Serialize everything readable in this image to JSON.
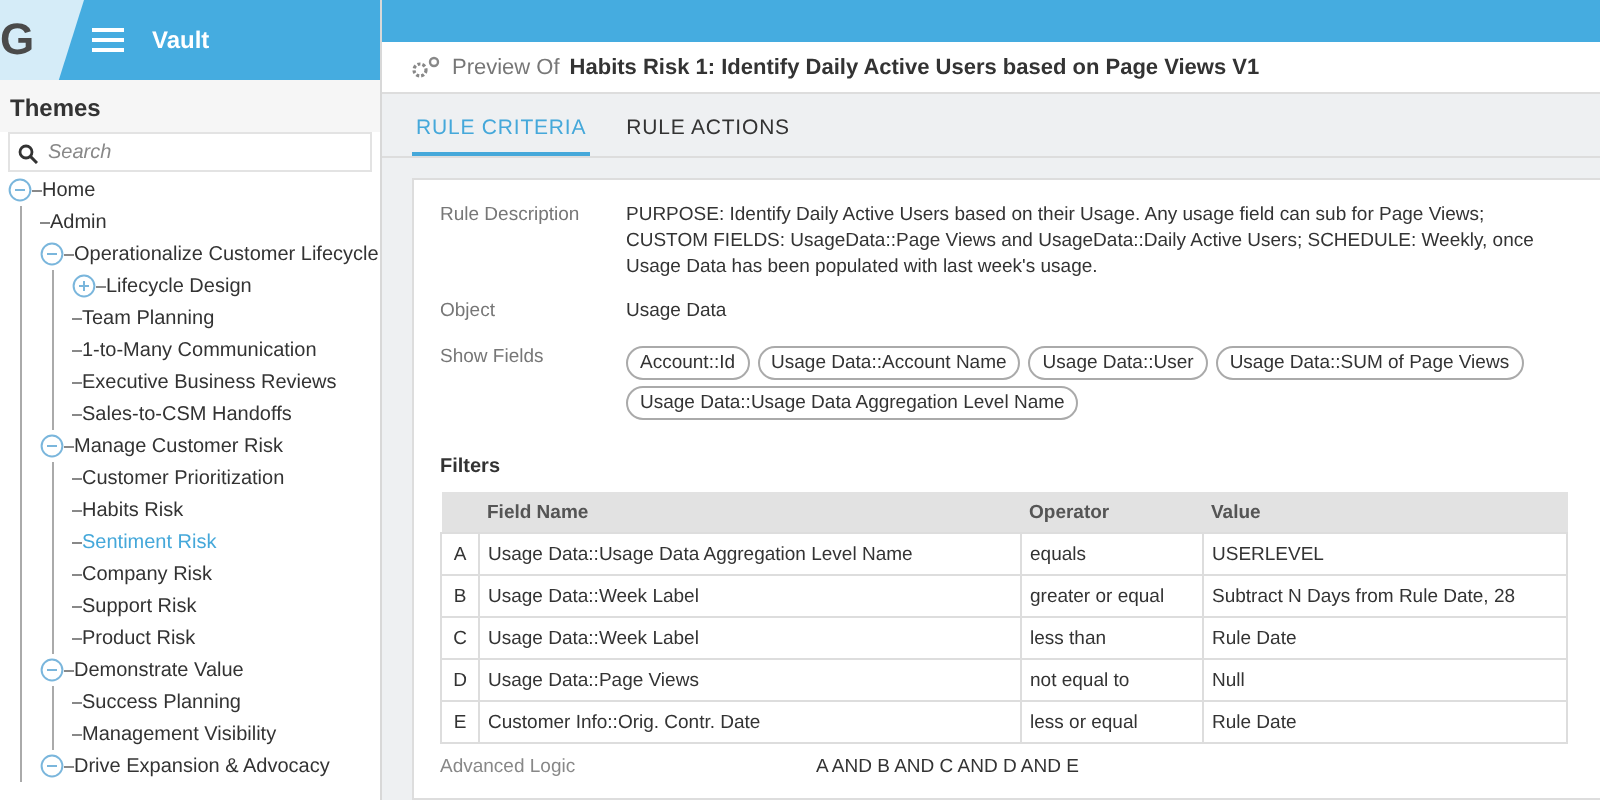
{
  "app": {
    "logo": "G",
    "title": "Vault"
  },
  "sidebar": {
    "heading": "Themes",
    "search": {
      "placeholder": "Search"
    },
    "tree": [
      {
        "label": "Home",
        "expanded": true,
        "selected": false,
        "children": [
          {
            "label": "Admin",
            "selected": false
          },
          {
            "label": "Operationalize Customer Lifecycle",
            "expanded": true,
            "selected": false,
            "children": [
              {
                "label": "Lifecycle Design",
                "expanded": false,
                "selected": false
              },
              {
                "label": "Team Planning",
                "selected": false
              },
              {
                "label": "1-to-Many Communication",
                "selected": false
              },
              {
                "label": "Executive Business Reviews",
                "selected": false
              },
              {
                "label": "Sales-to-CSM Handoffs",
                "selected": false
              }
            ]
          },
          {
            "label": "Manage Customer Risk",
            "expanded": true,
            "selected": false,
            "children": [
              {
                "label": "Customer Prioritization",
                "selected": false
              },
              {
                "label": "Habits Risk",
                "selected": false
              },
              {
                "label": "Sentiment Risk",
                "selected": true
              },
              {
                "label": "Company Risk",
                "selected": false
              },
              {
                "label": "Support Risk",
                "selected": false
              },
              {
                "label": "Product Risk",
                "selected": false
              }
            ]
          },
          {
            "label": "Demonstrate Value",
            "expanded": true,
            "selected": false,
            "children": [
              {
                "label": "Success Planning",
                "selected": false
              },
              {
                "label": "Management Visibility",
                "selected": false
              }
            ]
          },
          {
            "label": "Drive Expansion & Advocacy",
            "expanded": true,
            "selected": false
          }
        ]
      }
    ]
  },
  "preview": {
    "prefix": "Preview Of",
    "title": "Habits Risk 1: Identify Daily Active Users based on Page Views V1",
    "tabs": [
      {
        "label": "RULE CRITERIA",
        "selected": true
      },
      {
        "label": "RULE ACTIONS",
        "selected": false
      }
    ],
    "rule_description_label": "Rule Description",
    "rule_description": "PURPOSE: Identify Daily Active Users based on their Usage. Any usage field can sub for Page Views; CUSTOM FIELDS: UsageData::Page Views and UsageData::Daily Active Users; SCHEDULE: Weekly, once Usage Data has been populated with last week's usage.",
    "object_label": "Object",
    "object": "Usage Data",
    "show_fields_label": "Show Fields",
    "show_fields": [
      "Account::Id",
      "Usage Data::Account Name",
      "Usage Data::User",
      "Usage Data::SUM of Page Views",
      "Usage Data::Usage Data Aggregation Level Name"
    ],
    "filters": {
      "heading": "Filters",
      "columns": [
        "Field Name",
        "Operator",
        "Value"
      ],
      "rows": [
        {
          "key": "A",
          "field": "Usage Data::Usage Data Aggregation Level Name",
          "operator": "equals",
          "value": "USERLEVEL"
        },
        {
          "key": "B",
          "field": "Usage Data::Week Label",
          "operator": "greater or equal",
          "value": "Subtract N Days from Rule Date, 28"
        },
        {
          "key": "C",
          "field": "Usage Data::Week Label",
          "operator": "less than",
          "value": "Rule Date"
        },
        {
          "key": "D",
          "field": "Usage Data::Page Views",
          "operator": "not equal to",
          "value": "Null"
        },
        {
          "key": "E",
          "field": "Customer Info::Orig. Contr. Date",
          "operator": "less or equal",
          "value": "Rule Date"
        }
      ]
    },
    "advanced_logic_label": "Advanced Logic",
    "advanced_logic": "A AND B AND C AND D AND E"
  }
}
